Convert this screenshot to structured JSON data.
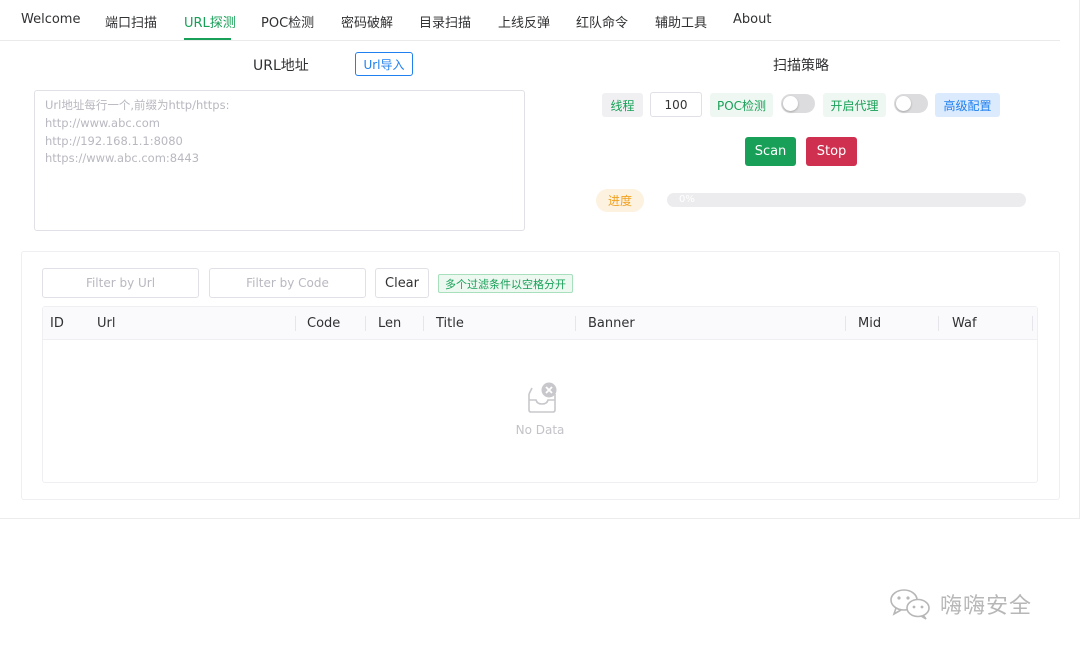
{
  "tabs": [
    {
      "label": "Welcome"
    },
    {
      "label": "端口扫描"
    },
    {
      "label": "URL探测"
    },
    {
      "label": "POC检测"
    },
    {
      "label": "密码破解"
    },
    {
      "label": "目录扫描"
    },
    {
      "label": "上线反弹"
    },
    {
      "label": "红队命令"
    },
    {
      "label": "辅助工具"
    },
    {
      "label": "About"
    }
  ],
  "active_tab": "URL探测",
  "url_section": {
    "title": "URL地址",
    "import_label": "Url导入",
    "placeholder_lines": [
      "Url地址每行一个,前缀为http/https:",
      "http://www.abc.com",
      "http://192.168.1.1:8080",
      "https://www.abc.com:8443"
    ]
  },
  "strategy": {
    "title": "扫描策略",
    "threads_label": "线程",
    "threads_value": "100",
    "poc_label": "POC检测",
    "poc_enabled": false,
    "proxy_label": "开启代理",
    "proxy_enabled": false,
    "advanced_label": "高级配置",
    "scan_label": "Scan",
    "stop_label": "Stop",
    "progress_label": "进度",
    "progress_text": "0%",
    "progress_value": 0
  },
  "filters": {
    "url_placeholder": "Filter by Url",
    "code_placeholder": "Filter by Code",
    "clear_label": "Clear",
    "hint": "多个过滤条件以空格分开"
  },
  "table": {
    "columns": [
      "ID",
      "Url",
      "Code",
      "Len",
      "Title",
      "Banner",
      "Mid",
      "Waf"
    ],
    "rows": [],
    "empty_text": "No Data"
  },
  "watermark": {
    "text": "嗨嗨安全",
    "icon": "wechat-icon"
  },
  "colors": {
    "primary": "#18a058",
    "info": "#2080f0",
    "error": "#d03050",
    "warning": "#f0a020"
  }
}
